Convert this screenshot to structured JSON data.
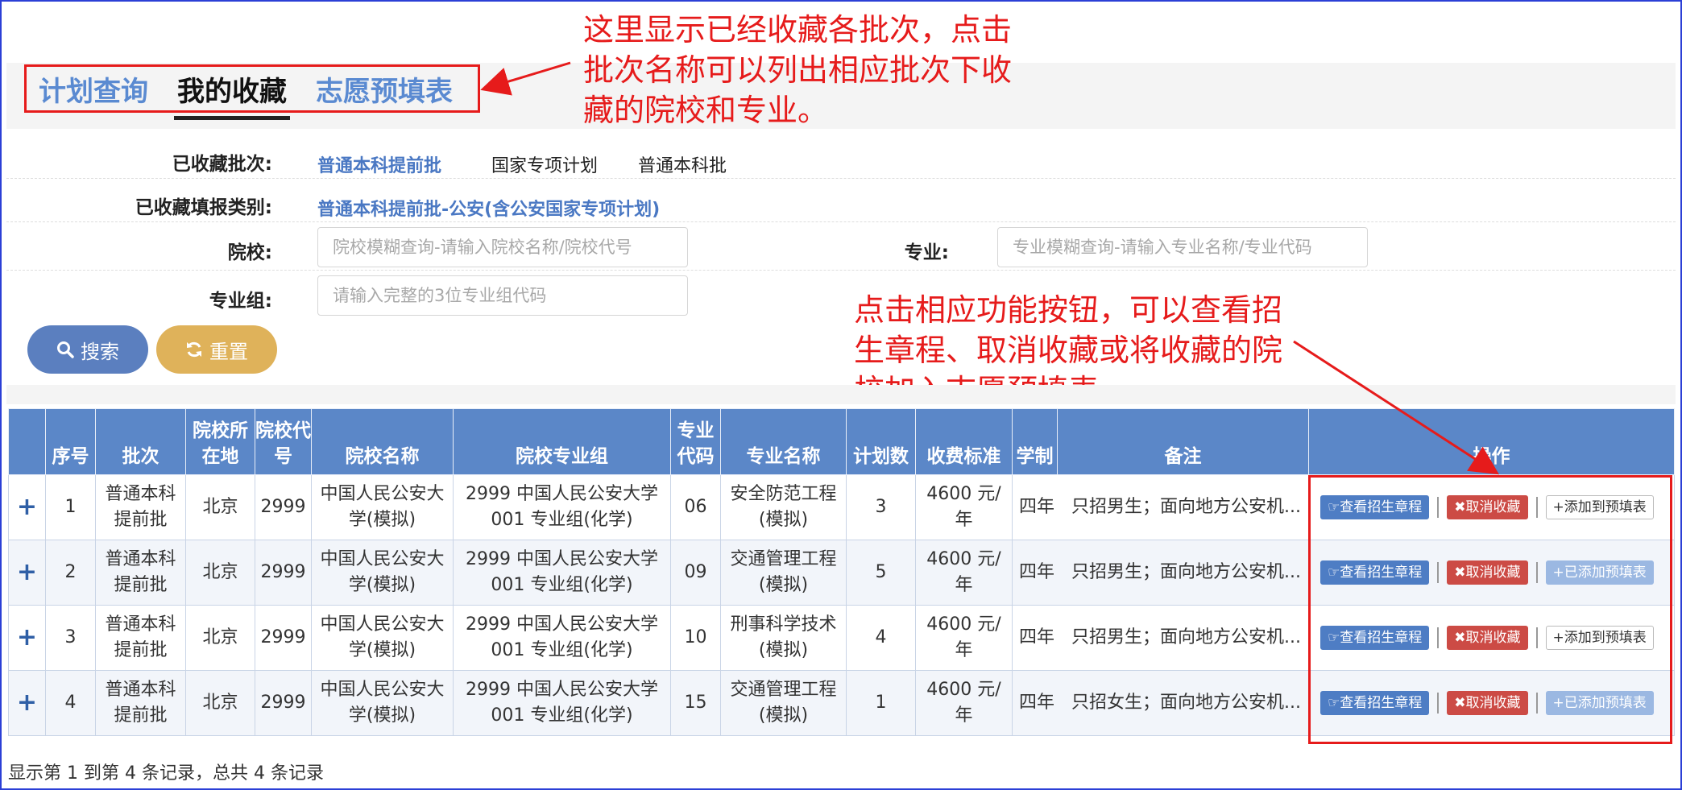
{
  "tabs": [
    {
      "label": "计划查询",
      "active": false
    },
    {
      "label": "我的收藏",
      "active": true
    },
    {
      "label": "志愿预填表",
      "active": false
    }
  ],
  "annotations": {
    "note1": "这里显示已经收藏各批次，点击批次名称可以列出相应批次下收藏的院校和专业。",
    "note2": "点击相应功能按钮，可以查看招生章程、取消收藏或将收藏的院校加入志愿预填表。"
  },
  "filters": {
    "batch_label": "已收藏批次:",
    "batches": [
      "普通本科提前批",
      "国家专项计划",
      "普通本科批"
    ],
    "category_label": "已收藏填报类别:",
    "category": "普通本科提前批-公安(含公安国家专项计划)",
    "school_label": "院校:",
    "school_placeholder": "院校模糊查询-请输入院校名称/院校代号",
    "major_label": "专业:",
    "major_placeholder": "专业模糊查询-请输入专业名称/专业代码",
    "group_label": "专业组:",
    "group_placeholder": "请输入完整的3位专业组代码"
  },
  "buttons": {
    "search": "搜索",
    "reset": "重置"
  },
  "table": {
    "headers": {
      "seq": "序号",
      "batch": "批次",
      "location": "院校所在地",
      "code": "院校代号",
      "school": "院校名称",
      "group": "院校专业组",
      "mcode": "专业代码",
      "major": "专业名称",
      "plan": "计划数",
      "fee": "收费标准",
      "years": "学制",
      "remark": "备注",
      "ops": "操作"
    },
    "rows": [
      {
        "plus": "+",
        "seq": "1",
        "batch": "普通本科提前批",
        "location": "北京",
        "code": "2999",
        "school": "中国人民公安大学(模拟)",
        "group": "2999 中国人民公安大学 001 专业组(化学)",
        "mcode": "06",
        "major": "安全防范工程(模拟)",
        "plan": "3",
        "fee": "4600 元/年",
        "years": "四年",
        "remark": "只招男生；面向地方公安机...",
        "view": "查看招生章程",
        "cancel": "取消收藏",
        "add": "添加到预填表",
        "added": false
      },
      {
        "plus": "+",
        "seq": "2",
        "batch": "普通本科提前批",
        "location": "北京",
        "code": "2999",
        "school": "中国人民公安大学(模拟)",
        "group": "2999 中国人民公安大学 001 专业组(化学)",
        "mcode": "09",
        "major": "交通管理工程(模拟)",
        "plan": "5",
        "fee": "4600 元/年",
        "years": "四年",
        "remark": "只招男生；面向地方公安机...",
        "view": "查看招生章程",
        "cancel": "取消收藏",
        "add": "已添加预填表",
        "added": true
      },
      {
        "plus": "+",
        "seq": "3",
        "batch": "普通本科提前批",
        "location": "北京",
        "code": "2999",
        "school": "中国人民公安大学(模拟)",
        "group": "2999 中国人民公安大学 001 专业组(化学)",
        "mcode": "10",
        "major": "刑事科学技术(模拟)",
        "plan": "4",
        "fee": "4600 元/年",
        "years": "四年",
        "remark": "只招男生；面向地方公安机...",
        "view": "查看招生章程",
        "cancel": "取消收藏",
        "add": "添加到预填表",
        "added": false
      },
      {
        "plus": "+",
        "seq": "4",
        "batch": "普通本科提前批",
        "location": "北京",
        "code": "2999",
        "school": "中国人民公安大学(模拟)",
        "group": "2999 中国人民公安大学 001 专业组(化学)",
        "mcode": "15",
        "major": "交通管理工程(模拟)",
        "plan": "1",
        "fee": "4600 元/年",
        "years": "四年",
        "remark": "只招女生；面向地方公安机...",
        "view": "查看招生章程",
        "cancel": "取消收藏",
        "add": "已添加预填表",
        "added": true
      }
    ]
  },
  "footer": "显示第 1 到第 4 条记录，总共 4 条记录",
  "colors": {
    "accent": "#5b87c8",
    "annotation": "#e61b1b",
    "reset": "#dfb25a",
    "cancel": "#cc4b45"
  }
}
